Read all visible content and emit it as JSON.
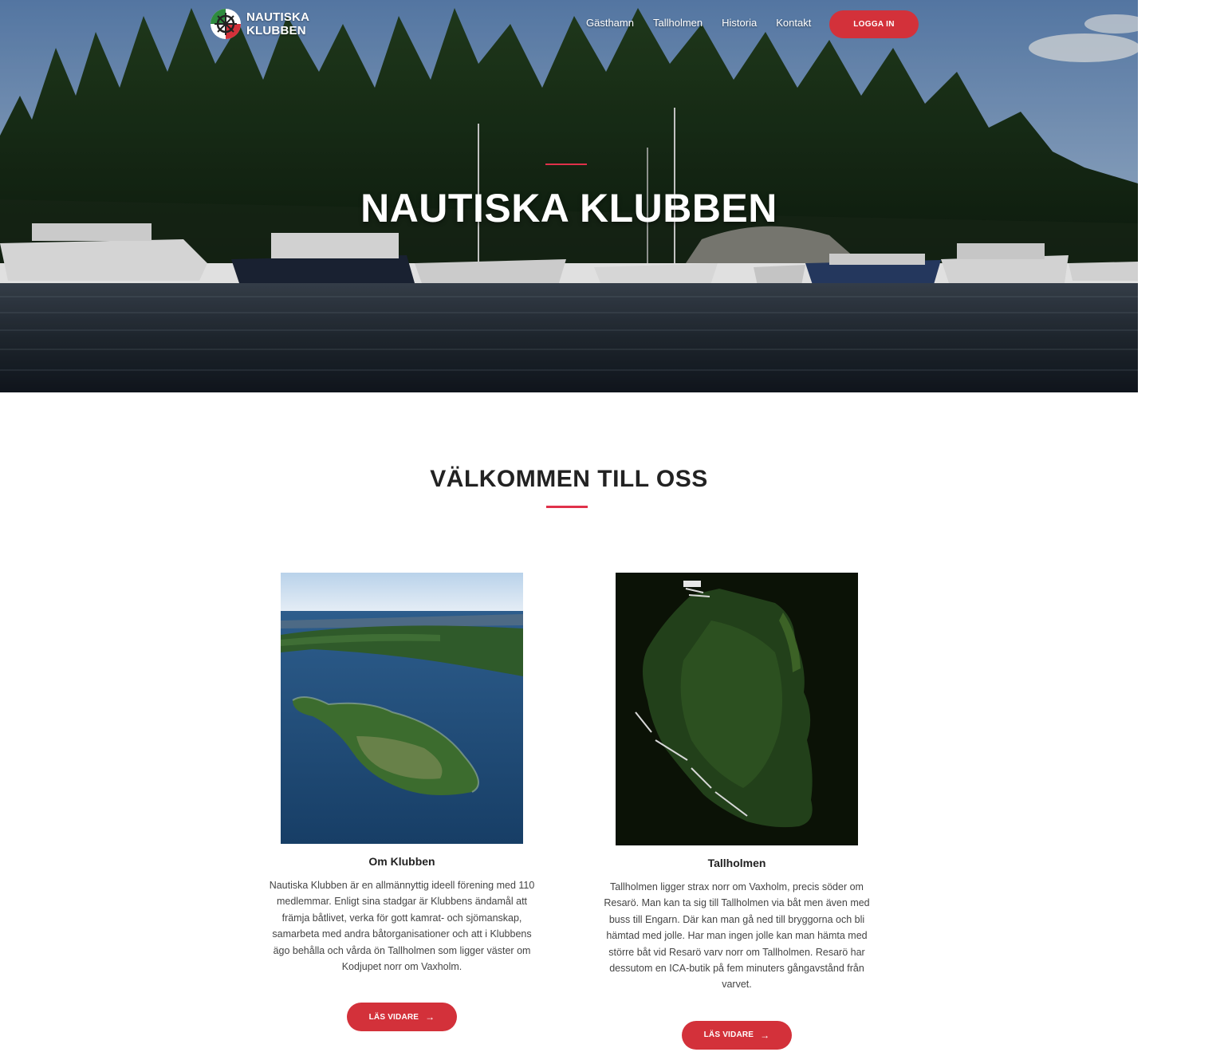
{
  "brand": {
    "line1": "NAUTISKA",
    "line2": "KLUBBEN"
  },
  "nav": {
    "items": [
      {
        "label": "Gästhamn"
      },
      {
        "label": "Tallholmen"
      },
      {
        "label": "Historia"
      },
      {
        "label": "Kontakt"
      }
    ],
    "login_label": "LOGGA IN"
  },
  "hero": {
    "title": "NAUTISKA KLUBBEN"
  },
  "welcome": {
    "title": "VÄLKOMMEN TILL OSS"
  },
  "cards": [
    {
      "title": "Om Klubben",
      "text": "Nautiska Klubben är en allmännyttig ideell förening med 110 medlemmar. Enligt sina stadgar är Klubbens ändamål att främja båtlivet, verka för gott kamrat- och sjömanskap, samarbeta med andra båtorganisationer och att i Klubbens ägo behålla och vårda ön Tallholmen som ligger väster om Kodjupet norr om Vaxholm.",
      "button_label": "LÄS VIDARE"
    },
    {
      "title": "Tallholmen",
      "text": "Tallholmen ligger strax norr om Vaxholm, precis söder om Resarö. Man kan ta sig till Tallholmen via båt men även med buss till Engarn. Där kan man gå ned till bryggorna och bli hämtad med jolle. Har man ingen jolle kan man hämta med större båt vid Resarö varv norr om Tallholmen. Resarö har dessutom en ICA-butik på fem minuters gångavstånd från varvet.",
      "button_label": "LÄS VIDARE"
    }
  ],
  "icons": {
    "arrow": "→",
    "logo": "ship-wheel-icon"
  },
  "colors": {
    "accent": "#d3313a",
    "rule": "#e0314a",
    "heading": "#222222"
  }
}
